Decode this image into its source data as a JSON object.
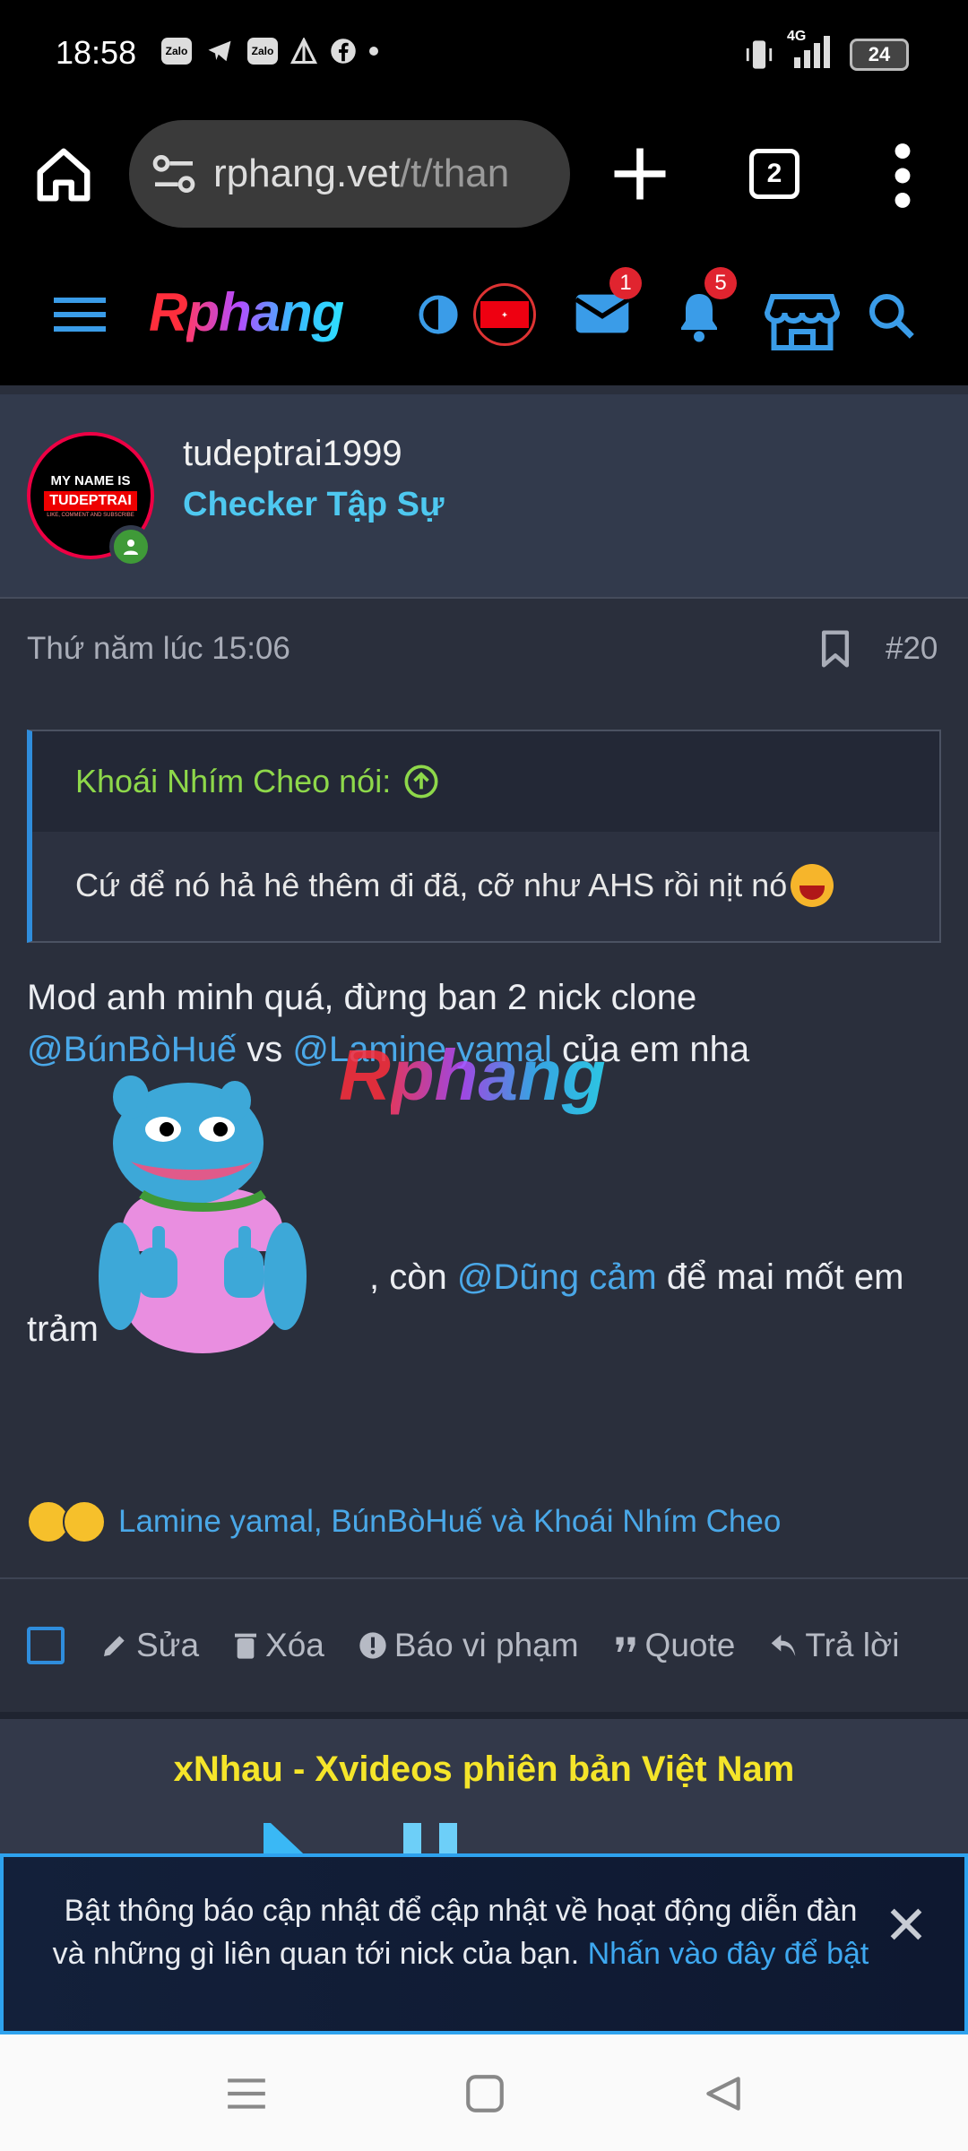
{
  "status_bar": {
    "time": "18:58",
    "notification_icons": [
      "zalo-icon",
      "telegram-icon",
      "zalo-icon",
      "app-icon",
      "facebook-icon"
    ],
    "network": "4G",
    "battery": "24"
  },
  "browser": {
    "url_host": "rphang.vet",
    "url_path": "/t/than",
    "tab_count": "2"
  },
  "site": {
    "logo_r": "R",
    "logo_rest": "phang",
    "mail_badge": "1",
    "alerts_badge": "5"
  },
  "post": {
    "avatar_line1": "MY NAME IS",
    "avatar_line2": "TUDEPTRAI",
    "avatar_line3": "LIKE, COMMENT AND SUBSCRIBE",
    "username": "tudeptrai1999",
    "user_title": "Checker Tập Sự",
    "timestamp": "Thứ năm lúc 15:06",
    "number": "#20",
    "quote_author": "Khoái Nhím Cheo nói:",
    "quote_text": "Cứ để nó hả hê thêm đi đã, cỡ như AHS rồi nịt nó",
    "line1": "Mod anh minh quá, đừng ban 2 nick clone",
    "mention1": "@BúnBòHuế",
    "vs": " vs ",
    "mention2": "@Lamine yamal",
    "line2_tail": " của em nha",
    "line3_pre": ", còn ",
    "mention3": "@Dũng cảm",
    "line3_tail": " để mai mốt em",
    "line4": "trảm",
    "reactions": "Lamine yamal, BúnBòHuế và Khoái Nhím Cheo"
  },
  "actions": {
    "edit": "Sửa",
    "delete": "Xóa",
    "report": "Báo vi phạm",
    "quote": "Quote",
    "reply": "Trả lời"
  },
  "promo": {
    "title": "xNhau - Xvideos phiên bản Việt Nam"
  },
  "notice": {
    "text": "Bật thông báo cập nhật để cập nhật về hoạt động diễn đàn và những gì liên quan tới nick của bạn.",
    "link": "Nhấn vào đây để bật"
  },
  "colors": {
    "accent": "#2f8ddc",
    "mention": "#4aa8e8",
    "user_title": "#4ec8f0",
    "quote_author": "#8ed84a",
    "promo_title": "#f5e52a"
  }
}
